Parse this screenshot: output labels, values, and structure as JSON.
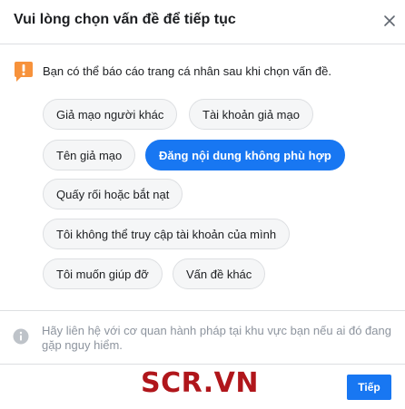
{
  "dialog": {
    "title": "Vui lòng chọn vấn đề để tiếp tục",
    "notice": "Bạn có thể báo cáo trang cá nhân sau khi chọn vấn đề.",
    "options": [
      "Giả mạo người khác",
      "Tài khoản giả mạo",
      "Tên giả mạo",
      "Đăng nội dung không phù hợp",
      "Quấy rối hoặc bắt nạt",
      "Tôi không thể truy cập tài khoản của mình",
      "Tôi muốn giúp đỡ",
      "Vấn đề khác"
    ],
    "selected_option": "Đăng nội dung không phù hợp",
    "info": "Hãy liên hệ với cơ quan hành pháp tại khu vực bạn nếu ai đó đang gặp nguy hiểm.",
    "next_label": "Tiếp",
    "watermark": "SCR.VN"
  },
  "colors": {
    "accent": "#1877f2",
    "warning": "#f7923b",
    "watermark": "#b0161b"
  },
  "icons": {
    "close": "close-icon",
    "warning": "warning-icon",
    "info": "info-icon"
  }
}
